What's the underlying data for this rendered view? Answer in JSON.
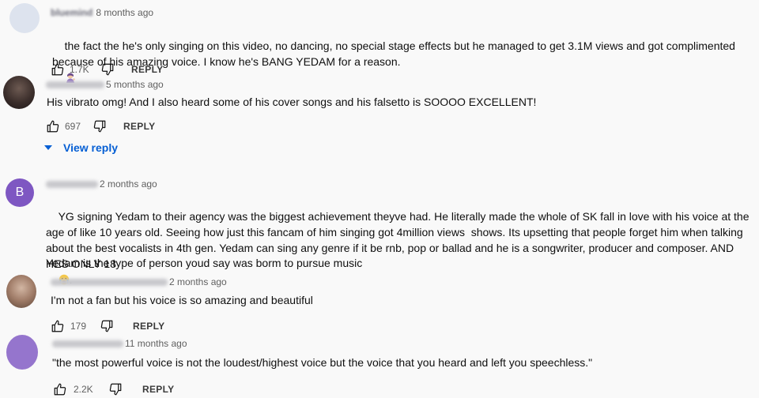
{
  "comments": [
    {
      "author": "bluemind",
      "time": "8 months ago",
      "text": "the fact the he's only singing on this video, no dancing, no special stage effects but he managed to get 3.1M views and got complimented because of his amazing voice. I know he's BANG YEDAM for a reason.",
      "likes": "1.7K",
      "reply": "REPLY",
      "avatar_color": "#dde3ee"
    },
    {
      "time": "5 months ago",
      "text": "His vibrato omg! And I also heard some of his cover songs and his falsetto is SOOOO EXCELLENT!",
      "likes": "697",
      "reply": "REPLY",
      "view_reply": "View reply"
    },
    {
      "time": "2 months ago",
      "text": "YG signing Yedam to their agency was the biggest achievement theyve had. He literally made the whole of SK fall in love with his voice at the age of like 10 years old. Seeing how just this fancam of him singing got 4million views  shows. Its upsetting that people forget him when talking about the best vocalists in 4th gen. Yedam can sing any genre if it be rnb, pop or ballad and he is a songwriter, producer and composer. AND HES ONLY 18",
      "text_tail": ".",
      "text2": "Yedam is the type of person youd say was borm to pursue music",
      "avatar_letter": "B",
      "avatar_color": "#7e57c2"
    },
    {
      "time": "2 months ago",
      "text": "I'm not a fan but his voice is so amazing and beautiful",
      "likes": "179",
      "reply": "REPLY"
    },
    {
      "time": "11 months ago",
      "text": "\"the most powerful voice is not the loudest/highest voice but the voice that you heard and left you speechless.\"",
      "likes": "2.2K",
      "reply": "REPLY",
      "avatar_color": "#9575cd"
    }
  ],
  "icons": {
    "like": "thumb-up-icon",
    "dislike": "thumb-down-icon",
    "expand": "caret-down-icon",
    "emoji1": "woman-tipping-hand-emoji",
    "emoji2": "crying-face-emoji"
  },
  "colors": {
    "link": "#065fd4",
    "meta": "#606060",
    "text": "#0f0f0f",
    "background": "#f9f9f9"
  }
}
